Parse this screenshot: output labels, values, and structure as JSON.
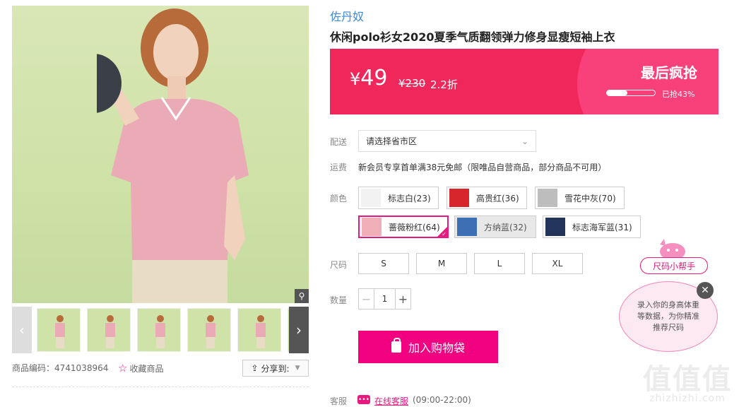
{
  "gallery": {
    "zoom_icon": "magnifier-icon",
    "thumbnail_count": 6,
    "product_code_label": "商品编码：",
    "product_code": "4741038964",
    "favorite_label": "收藏商品",
    "share_label": "分享到:"
  },
  "product": {
    "brand": "佐丹奴",
    "title": "休闲polo衫女2020夏季气质翻领弹力修身显瘦短袖上衣"
  },
  "price": {
    "currency": "¥",
    "current": "49",
    "original": "¥230",
    "discount": "2.2折",
    "flash_title": "最后疯抢",
    "sold_text": "已抢43%",
    "sold_fraction": 0.43,
    "bg_color": "#f0275b"
  },
  "delivery": {
    "label": "配送",
    "region_placeholder": "请选择省市区"
  },
  "shipping": {
    "label": "运费",
    "text": "新会员专享首单满38元免邮（限唯品自营商品，部分商品不可用）"
  },
  "colors": {
    "label": "颜色",
    "options": [
      {
        "name": "标志白(23)",
        "swatch": "#f2f2f2"
      },
      {
        "name": "高贵红(36)",
        "swatch": "#d8272c"
      },
      {
        "name": "雪花中灰(70)",
        "swatch": "#bdbdbd"
      },
      {
        "name": "蔷薇粉红(64)",
        "swatch": "#f0aeb9"
      },
      {
        "name": "方纳蓝(32)",
        "swatch": "#3d6fb5"
      },
      {
        "name": "标志海军蓝(31)",
        "swatch": "#22345a"
      }
    ],
    "selected": "蔷薇粉红(64)"
  },
  "sizes": {
    "label": "尺码",
    "options": [
      "S",
      "M",
      "L",
      "XL"
    ]
  },
  "quantity": {
    "label": "数量",
    "value": "1",
    "minus": "−",
    "plus": "+"
  },
  "cart": {
    "button_label": "加入购物袋",
    "button_color": "#f10180"
  },
  "service": {
    "label": "客服",
    "link": "在线客服",
    "hours": "(09:00-22:00)"
  },
  "size_helper": {
    "tag": "尺码小帮手",
    "bubble": "录入你的身高体重等数据，为你精准推荐尺码",
    "close_icon": "close-icon"
  },
  "watermark": {
    "logo": "值值值",
    "text": "zhizhizhi.com"
  }
}
